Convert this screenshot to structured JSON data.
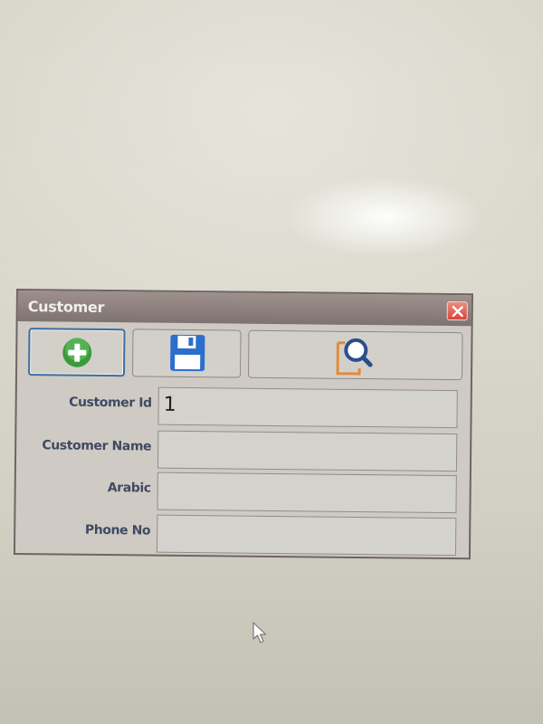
{
  "window": {
    "title": "Customer"
  },
  "toolbar": {
    "buttons": [
      {
        "icon": "add-icon",
        "color": "#3a9b3a"
      },
      {
        "icon": "save-icon",
        "color": "#2a6fcb"
      },
      {
        "icon": "search-document-icon",
        "color": "#e58a3a"
      }
    ]
  },
  "form": {
    "fields": [
      {
        "label": "Customer Id",
        "value": "1"
      },
      {
        "label": "Customer Name",
        "value": ""
      },
      {
        "label": "Arabic",
        "value": ""
      },
      {
        "label": "Phone No",
        "value": ""
      }
    ]
  }
}
